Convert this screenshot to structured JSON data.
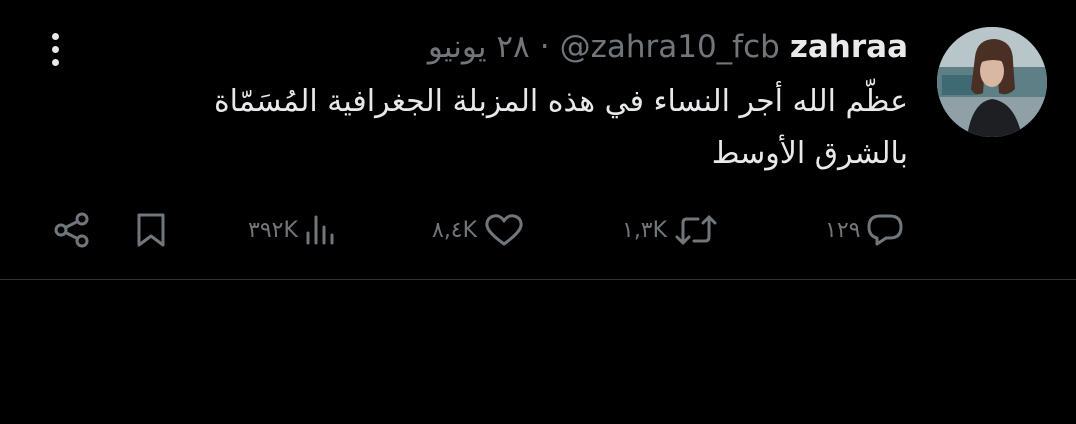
{
  "tweet": {
    "display_name": "zahraa",
    "handle": "@zahra10_fcb",
    "separator": "·",
    "date": "٢٨ يونيو",
    "text_line1": "عظّم الله أجر النساء في هذه المزبلة الجغرافية  المُسَمّاة",
    "text_line2": "بالشرق الأوسط"
  },
  "actions": {
    "replies": "١٢٩",
    "retweets": "١,٣K",
    "likes": "٨,٤K",
    "views": "٣٩٢K"
  },
  "icons": {
    "more": "more-vertical-icon",
    "reply": "reply-icon",
    "retweet": "retweet-icon",
    "like": "heart-icon",
    "views": "views-icon",
    "bookmark": "bookmark-icon",
    "share": "share-icon"
  },
  "colors": {
    "background": "#000000",
    "text": "#e7e9ea",
    "muted": "#71767b",
    "divider": "#2f3336"
  }
}
